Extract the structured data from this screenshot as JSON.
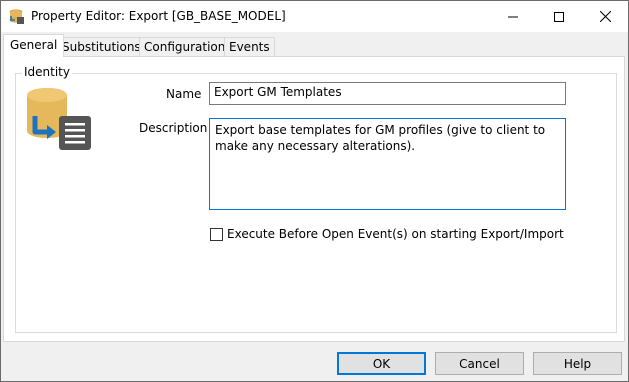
{
  "window": {
    "title": "Property Editor: Export [GB_BASE_MODEL]"
  },
  "tabs": [
    {
      "label": "General",
      "active": true
    },
    {
      "label": "Substitutions",
      "active": false
    },
    {
      "label": "Configuration",
      "active": false
    },
    {
      "label": "Events",
      "active": false
    }
  ],
  "identity": {
    "group_label": "Identity",
    "name_label": "Name",
    "name_value": "Export GM Templates",
    "description_label": "Description",
    "description_value": "Export base templates for GM profiles (give to client to make any necessary alterations)."
  },
  "option": {
    "checkbox_label": "Execute Before Open Event(s) on starting Export/Import",
    "checked": false
  },
  "buttons": {
    "ok": "OK",
    "cancel": "Cancel",
    "help": "Help"
  },
  "icons": {
    "app": "database-export-icon",
    "minimize": "minimize-icon",
    "maximize": "maximize-icon",
    "close": "close-icon",
    "identity": "database-export-icon"
  },
  "colors": {
    "accent": "#0078d7",
    "db_gold": "#e6b85c",
    "arrow_blue": "#1e73be",
    "doc_gray": "#555555"
  }
}
